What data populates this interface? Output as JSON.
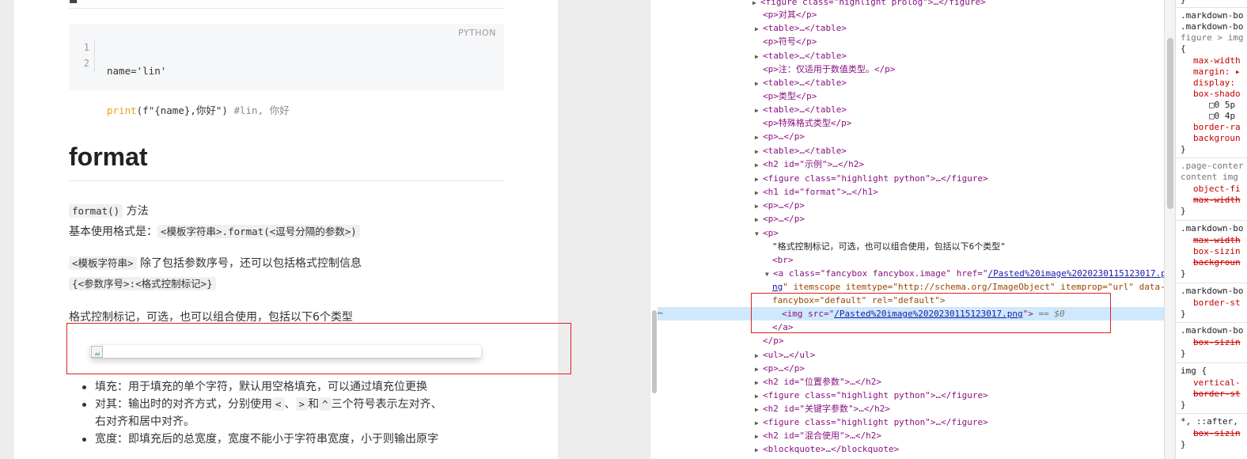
{
  "blog": {
    "code": {
      "lang": "PYTHON",
      "line_numbers": [
        "1",
        "2"
      ],
      "line1": "name='lin'",
      "line2_fn": "print",
      "line2_args": "(f\"{name},你好\") ",
      "line2_comment": "#lin, 你好"
    },
    "heading": "format",
    "p1_code": "format()",
    "p1_text": " 方法",
    "p2_text": "基本使用格式是：",
    "p2_code": "<模板字符串>.format(<逗号分隔的参数>)",
    "p3_code": "<模板字符串>",
    "p3_text": " 除了包括参数序号，还可以包括格式控制信息",
    "p4_code": "{<参数序号>:<格式控制标记>}",
    "p5_text": "格式控制标记，可选，也可以组合使用，包括以下6个类型",
    "bullets": {
      "b1": "填充：用于填充的单个字符，默认用空格填充，可以通过填充位更换",
      "b2_a": "对其：输出时的对齐方式，分别使用",
      "b2_c1": "<",
      "b2_sep": "、",
      "b2_c2": ">",
      "b2_and": "和",
      "b2_c3": "^",
      "b2_b": "三个符号表示左对齐、",
      "b2_cont": "右对齐和居中对齐。",
      "b3": "宽度：即填充后的总宽度，宽度不能小于字符串宽度，小于则输出原字"
    }
  },
  "elements": {
    "r0": "<figure class=\"highlight prolog\">…</figure>",
    "r1": "<p>对其</p>",
    "r2": "<table>…</table>",
    "r3": "<p>符号</p>",
    "r4": "<table>…</table>",
    "r5": "<p>注：仅适用于数值类型。</p>",
    "r6": "<table>…</table>",
    "r7": "<p>类型</p>",
    "r8": "<table>…</table>",
    "r9": "<p>特殊格式类型</p>",
    "r10": "<p>…</p>",
    "r11": "<table>…</table>",
    "r12": "<h2 id=\"示例\">…</h2>",
    "r13": "<figure class=\"highlight python\">…</figure>",
    "r14": "<h1 id=\"format\">…</h1>",
    "r15": "<p>…</p>",
    "r16": "<p>…</p>",
    "r17": "<p>",
    "r18": "\"格式控制标记，可选，也可以组合使用，包括以下6个类型\"",
    "r19": "<br>",
    "r20_pre": "<a class=\"fancybox fancybox.image\" href=\"",
    "r20_link": "/Pasted%20image%2020230115123017.p",
    "r21_link": "ng",
    "r21_rest": "\" itemscope itemtype=\"http://schema.org/ImageObject\" itemprop=\"url\" data-",
    "r22": "fancybox=\"default\" rel=\"default\">",
    "r23_pre": "<img src=\"",
    "r23_link": "/Pasted%20image%2020230115123017.png",
    "r23_post": "\">",
    "r23_ref": " == $0",
    "r24": "</a>",
    "r25": "</p>",
    "r26": "<ul>…</ul>",
    "r27": "<p>…</p>",
    "r28": "<h2 id=\"位置参数\">…</h2>",
    "r29": "<figure class=\"highlight python\">…</figure>",
    "r30": "<h2 id=\"关键字参数\">…</h2>",
    "r31": "<figure class=\"highlight python\">…</figure>",
    "r32": "<h2 id=\"混合使用\">…</h2>",
    "r33": "<blockquote>…</blockquote>",
    "dots": "⋯"
  },
  "styles": {
    "s0": "}",
    "s1": ".markdown-bo",
    "s2": ".markdown-bo",
    "s3": "figure > img",
    "s4": "{",
    "s5": "max-width",
    "s6": "margin: ▸",
    "s7": "display:",
    "s8": "box-shado",
    "s9": "□0 5p",
    "s10": "□0 4p",
    "s11": "border-ra",
    "s12": "backgroun",
    "s13": "}",
    "s14": ".page-conter",
    "s15": "content img",
    "s16": "object-fi",
    "s17": "max-width",
    "s18": "}",
    "s19": ".markdown-bo",
    "s20": "max-width",
    "s21": "box-sizin",
    "s22": "backgroun",
    "s23": "}",
    "s24": ".markdown-bo",
    "s25": "border-st",
    "s26": "}",
    "s27": ".markdown-bo",
    "s28": "box-sizin",
    "s29": "}",
    "s30": "img {",
    "s31": "vertical-",
    "s32": "border-st",
    "s33": "}",
    "s34": "*, ::after,",
    "s35": "box-sizin",
    "s36": "}"
  },
  "colors": {
    "highlight_box": "#e02020",
    "selected_row": "#cfe8fc",
    "tag": "#881280",
    "attr_name": "#994500",
    "attr_value": "#1a1aa6"
  }
}
